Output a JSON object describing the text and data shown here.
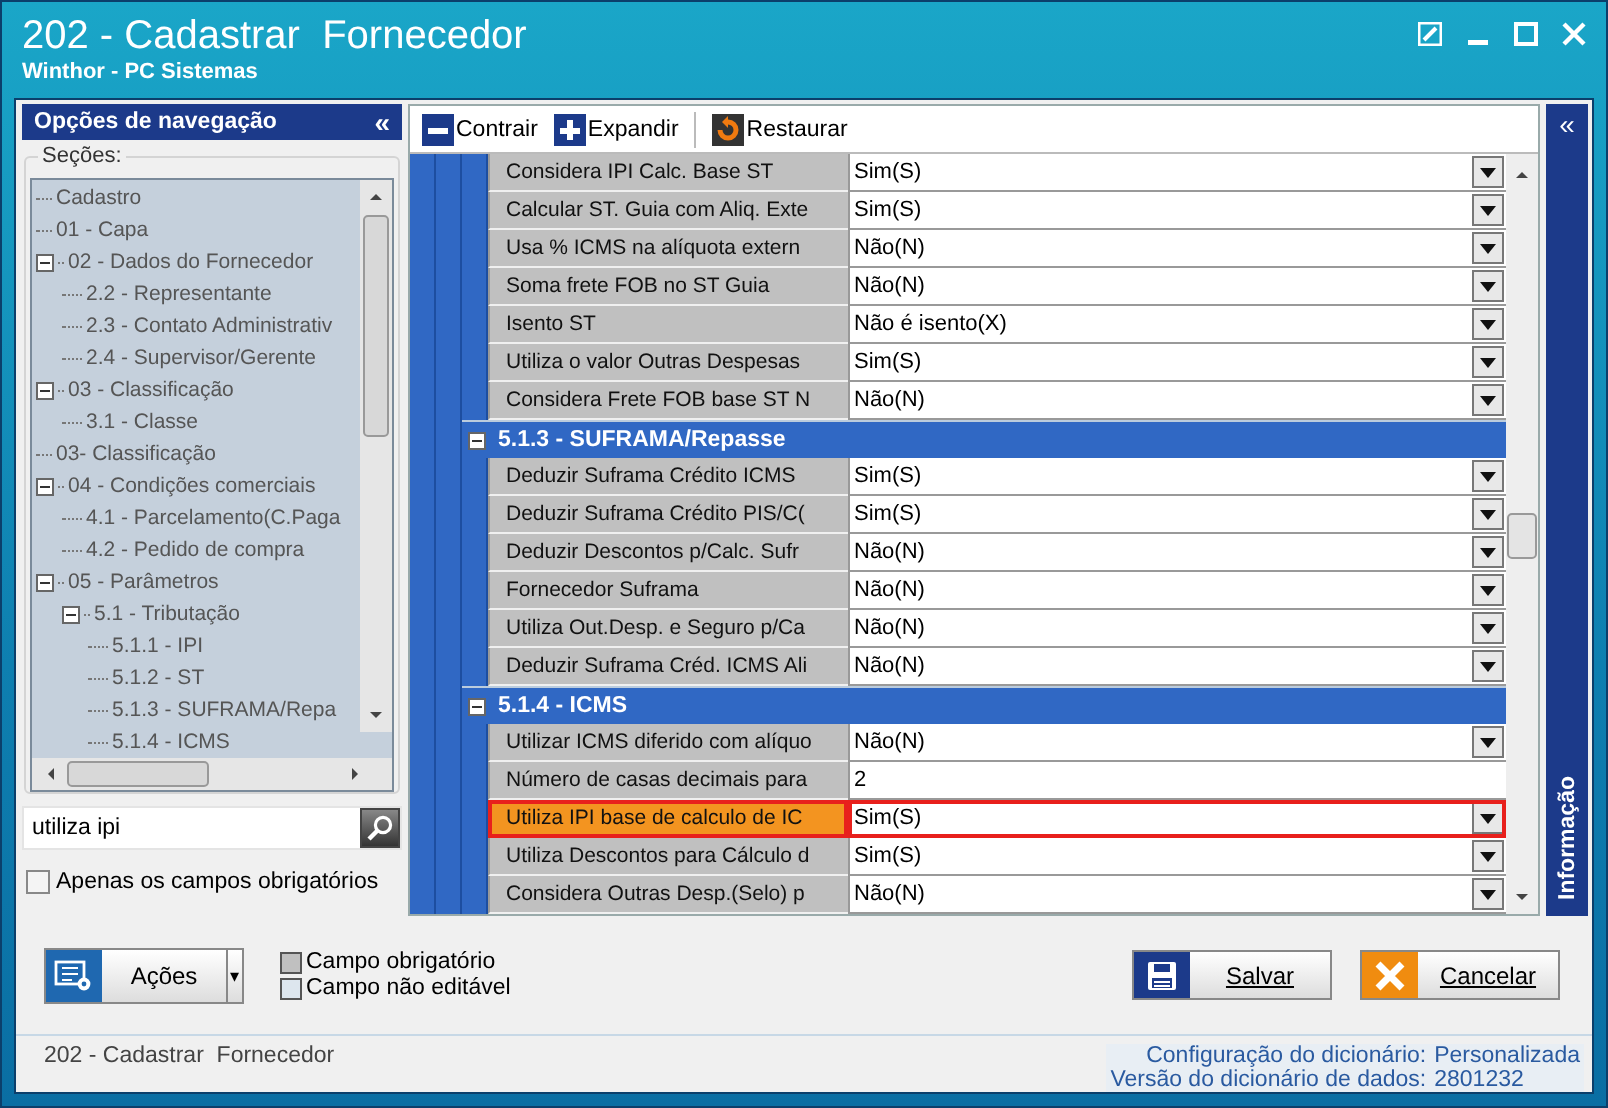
{
  "window": {
    "title": "202 - Cadastrar  Fornecedor",
    "subtitle": "Winthor - PC Sistemas"
  },
  "nav": {
    "title": "Opções de navegação",
    "collapse": "«",
    "group_label": "Seções:",
    "tree": [
      {
        "label": "Cadastro"
      },
      {
        "label": "01 - Capa"
      },
      {
        "label": "02 - Dados do Fornecedor",
        "expanded": true,
        "children": [
          {
            "label": "2.2 - Representante"
          },
          {
            "label": "2.3 - Contato Administrativ"
          },
          {
            "label": "2.4 - Supervisor/Gerente"
          }
        ]
      },
      {
        "label": "03 - Classificação",
        "expanded": true,
        "children": [
          {
            "label": "3.1 - Classe"
          }
        ]
      },
      {
        "label": "03- Classificação"
      },
      {
        "label": "04 - Condições comerciais",
        "expanded": true,
        "children": [
          {
            "label": "4.1 - Parcelamento(C.Paga"
          },
          {
            "label": "4.2 - Pedido de compra"
          }
        ]
      },
      {
        "label": "05 - Parâmetros",
        "expanded": true,
        "children": [
          {
            "label": "5.1 - Tributação",
            "expanded": true,
            "children": [
              {
                "label": "5.1.1 - IPI"
              },
              {
                "label": "5.1.2 - ST"
              },
              {
                "label": "5.1.3 - SUFRAMA/Repa"
              },
              {
                "label": "5.1.4 - ICMS"
              }
            ]
          }
        ]
      }
    ],
    "search": {
      "value": "utiliza ipi"
    },
    "only_required": {
      "label": "Apenas os campos obrigatórios",
      "checked": false
    }
  },
  "toolbar": [
    {
      "kind": "collapse",
      "label": "Contrair"
    },
    {
      "kind": "expand",
      "label": "Expandir"
    },
    {
      "kind": "restore",
      "label": "Restaurar"
    }
  ],
  "grid": {
    "rows": [
      {
        "kind": "field",
        "label": "Considera IPI Calc. Base ST",
        "value": "Sim(S)",
        "dropdown": true,
        "selected": false
      },
      {
        "kind": "field",
        "label": "Calcular ST. Guia com Aliq. Exte",
        "value": "Sim(S)",
        "dropdown": true,
        "selected": false
      },
      {
        "kind": "field",
        "label": "Usa % ICMS na alíquota extern",
        "value": "Não(N)",
        "dropdown": true,
        "selected": false
      },
      {
        "kind": "field",
        "label": "Soma frete FOB no ST Guia",
        "value": "Não(N)",
        "dropdown": true,
        "selected": false
      },
      {
        "kind": "field",
        "label": "Isento ST",
        "value": "Não é isento(X)",
        "dropdown": true,
        "selected": false
      },
      {
        "kind": "field",
        "label": "Utiliza o valor Outras Despesas",
        "value": "Sim(S)",
        "dropdown": true,
        "selected": false
      },
      {
        "kind": "field",
        "label": "Considera Frete FOB base ST N",
        "value": "Não(N)",
        "dropdown": true,
        "selected": false
      },
      {
        "kind": "section",
        "label": "5.1.3 - SUFRAMA/Repasse",
        "expanded": true
      },
      {
        "kind": "field",
        "label": "Deduzir Suframa Crédito ICMS",
        "value": "Sim(S)",
        "dropdown": true,
        "selected": false
      },
      {
        "kind": "field",
        "label": "Deduzir Suframa Crédito PIS/C(",
        "value": "Sim(S)",
        "dropdown": true,
        "selected": false
      },
      {
        "kind": "field",
        "label": "Deduzir Descontos p/Calc. Sufr",
        "value": "Não(N)",
        "dropdown": true,
        "selected": false
      },
      {
        "kind": "field",
        "label": "Fornecedor Suframa",
        "value": "Não(N)",
        "dropdown": true,
        "selected": false
      },
      {
        "kind": "field",
        "label": "Utiliza Out.Desp. e Seguro p/Ca",
        "value": "Não(N)",
        "dropdown": true,
        "selected": false
      },
      {
        "kind": "field",
        "label": "Deduzir Suframa Créd. ICMS Ali",
        "value": "Não(N)",
        "dropdown": true,
        "selected": false
      },
      {
        "kind": "section",
        "label": "5.1.4 - ICMS",
        "expanded": true
      },
      {
        "kind": "field",
        "label": "Utilizar ICMS diferido com alíquo",
        "value": "Não(N)",
        "dropdown": true,
        "selected": false
      },
      {
        "kind": "field",
        "label": "Número de casas decimais para",
        "value": "2",
        "dropdown": false,
        "selected": false
      },
      {
        "kind": "field",
        "label": "Utiliza IPI base de calculo de IC",
        "value": "Sim(S)",
        "dropdown": true,
        "selected": true
      },
      {
        "kind": "field",
        "label": "Utiliza Descontos para Cálculo d",
        "value": "Sim(S)",
        "dropdown": true,
        "selected": false
      },
      {
        "kind": "field",
        "label": "Considera Outras Desp.(Selo) p",
        "value": "Não(N)",
        "dropdown": true,
        "selected": false
      }
    ]
  },
  "info_panel": {
    "title": "Informação",
    "collapse": "«"
  },
  "actions_button": {
    "label": "Ações",
    "caret": "▾"
  },
  "legend": [
    {
      "kind": "required",
      "label": "Campo obrigatório"
    },
    {
      "kind": "readonly",
      "label": "Campo não editável"
    }
  ],
  "buttons": [
    {
      "kind": "save",
      "label": "Salvar"
    },
    {
      "kind": "cancel",
      "label": "Cancelar"
    }
  ],
  "status_bar": {
    "form": "202 - Cadastrar  Fornecedor",
    "items": [
      {
        "label": "Configuração do dicionário:",
        "value": "Personalizada"
      },
      {
        "label": "Versão do dicionário de dados:",
        "value": "2801232"
      }
    ]
  }
}
